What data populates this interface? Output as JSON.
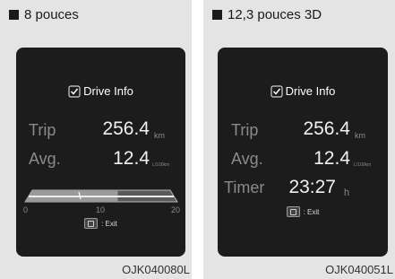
{
  "left": {
    "heading": "8 pouces",
    "screen_title": "Drive Info",
    "trip_label": "Trip",
    "trip_value": "256.4",
    "trip_unit": "km",
    "avg_label": "Avg.",
    "avg_value": "12.4",
    "avg_unit": "L/100km",
    "gauge": {
      "min": "0",
      "mid": "10",
      "max": "20",
      "value": 12.4
    },
    "exit_text": ": Exit",
    "ref": "OJK040080L"
  },
  "right": {
    "heading": "12,3 pouces 3D",
    "screen_title": "Drive Info",
    "trip_label": "Trip",
    "trip_value": "256.4",
    "trip_unit": "km",
    "avg_label": "Avg.",
    "avg_value": "12.4",
    "avg_unit": "L/100km",
    "timer_label": "Timer",
    "timer_value": "23:27",
    "timer_unit": "h",
    "exit_text": ": Exit",
    "ref": "OJK040051L"
  },
  "colors": {
    "panel_bg": "#e4e4e4",
    "screen_bg": "#1c1c1c"
  },
  "icons": [
    "checkbox-icon",
    "exit-button-icon"
  ]
}
